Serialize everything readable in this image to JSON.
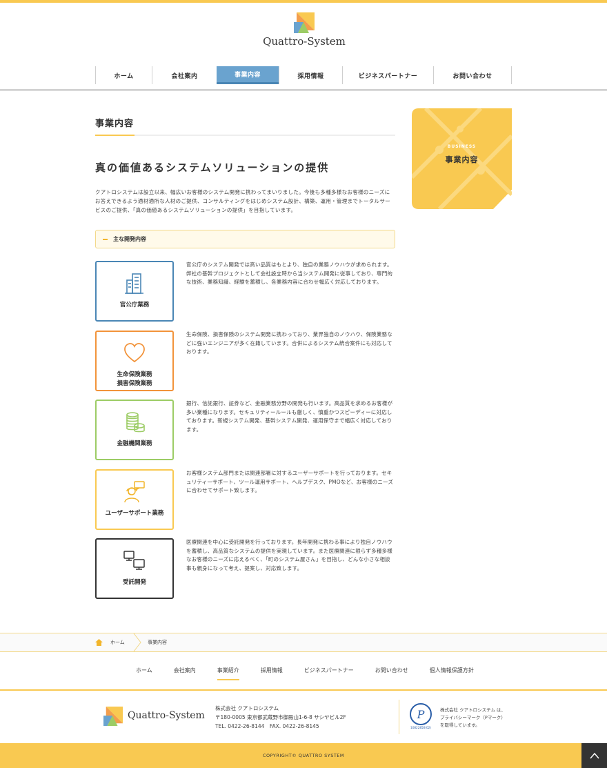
{
  "header": {
    "logo_text": "Quattro-System"
  },
  "nav": {
    "items": [
      {
        "label": "ホーム",
        "active": false
      },
      {
        "label": "会社案内",
        "active": false
      },
      {
        "label": "事業内容",
        "active": true
      },
      {
        "label": "採用情報",
        "active": false
      },
      {
        "label": "ビジネスパートナー",
        "active": false
      },
      {
        "label": "お問い合わせ",
        "active": false
      }
    ]
  },
  "main": {
    "page_title": "事業内容",
    "headline": "真の価値あるシステムソリューションの提供",
    "intro": "クアトロシステムは設立以来、幅広いお客様のシステム開発に携わってまいりました。今後も多種多様なお客様のニーズにお答えできるよう適材適所な人材のご提供、コンサルティングをはじめシステム設計、構築、運用・管理までトータルサービスのご提供、「真の価値あるシステムソリューションの提供」を目指しています。",
    "section_label": "主な開発内容",
    "businesses": [
      {
        "caption": "官公庁業務",
        "icon": "building-icon",
        "color": "#4a86b5",
        "description": "官公庁のシステム開発では高い品質はもとより、独自の業務ノウハウが求められます。弊社の基幹プロジェクトとして会社設立時から当システム開発に従事しており、専門的な技術、業務知識、経験を蓄積し、各業務内容に合わせ幅広く対応しております。"
      },
      {
        "caption": "生命保険業務\n損害保険業務",
        "icon": "heart-icon",
        "color": "#f2933a",
        "description": "生命保険、損害保険のシステム開発に携わっており、業界独自のノウハウ、保険業務などに強いエンジニアが多く在籍しています。合併によるシステム統合案件にも対応しております。"
      },
      {
        "caption": "金融機関業務",
        "icon": "coins-icon",
        "color": "#9ccc65",
        "description": "銀行、信託銀行、証券など、金融業務分野の開発も行います。高品質を求めるお客様が多い業種になります。セキュリティールールも厳しく、慎重かつスピーディーに対応しております。新規システム開発、基幹システム開発、運用保守まで幅広く対応しております。"
      },
      {
        "caption": "ユーザーサポート業務",
        "icon": "support-user-icon",
        "color": "#f9c951",
        "description": "お客様システム部門または関連部署に対するユーザーサポートを行っております。セキュリティーサポート、ツール運用サポート、ヘルプデスク、PMOなど、お客様のニーズに合わせてサポート致します。"
      },
      {
        "caption": "受託開発",
        "icon": "computers-icon",
        "color": "#333333",
        "description": "医療関連を中心に受託開発を行っております。長年開発に携わる事により独自ノウハウを蓄積し、高品質なシステムの提供を実現しています。また医療関連に限らず多種多様なお客様のニーズに応えるべく、「町のシステム屋さん」を目指し、どんな小さな相談事も親身になって考え、提案し、対応致します。"
      }
    ]
  },
  "side_banner": {
    "en": "BUSINESS",
    "jp": "事業内容"
  },
  "breadcrumb": {
    "home": "ホーム",
    "current": "事業内容"
  },
  "footer_nav": {
    "items": [
      {
        "label": "ホーム",
        "active": false
      },
      {
        "label": "会社案内",
        "active": false
      },
      {
        "label": "事業紹介",
        "active": true
      },
      {
        "label": "採用情報",
        "active": false
      },
      {
        "label": "ビジネスパートナー",
        "active": false
      },
      {
        "label": "お問い合わせ",
        "active": false
      },
      {
        "label": "個人情報保護方針",
        "active": false
      }
    ]
  },
  "footer": {
    "logo_text": "Quattro-System",
    "company": "株式会社 クアトロシステム",
    "address": "〒180-0005 東京都武蔵野市御殿山1-6-8 サシヤビル2F",
    "contact": "TEL. 0422-26-8144　FAX. 0422-26-8145",
    "pmark_line1": "株式会社 クアトロシステム は、",
    "pmark_line2": "プライバシーマーク（Pマーク）",
    "pmark_line3": "を取得しています。",
    "pmark_number": "10822850(02)",
    "copyright": "COPYRIGHT© QUATTRO SYSTEM"
  },
  "colors": {
    "accent": "#f9c951",
    "nav_active": "#6aa3cf"
  }
}
